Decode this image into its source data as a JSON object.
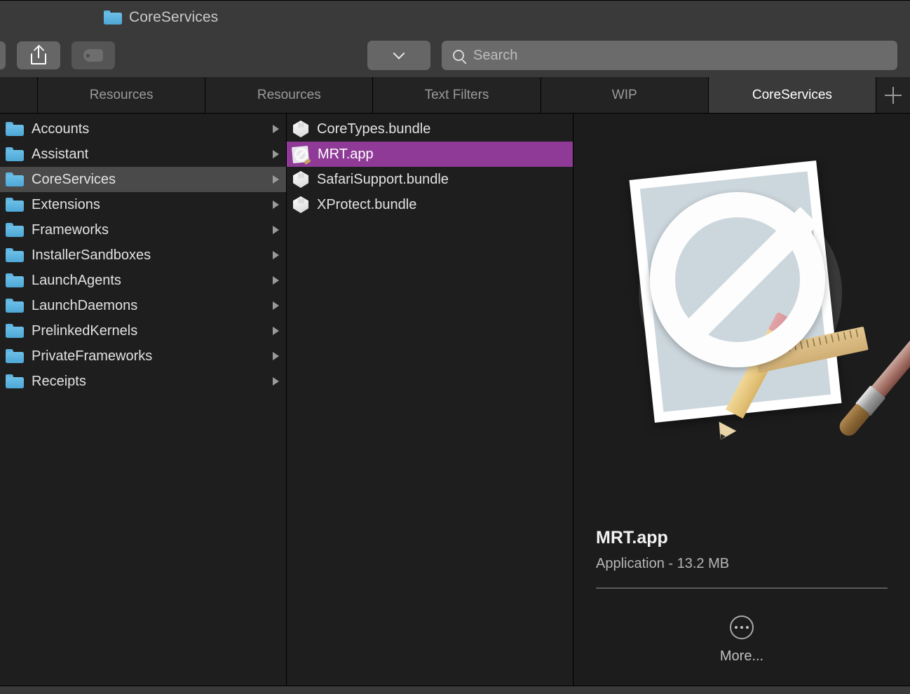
{
  "window": {
    "title": "CoreServices",
    "title_folder_icon": "folder-icon"
  },
  "toolbar": {
    "share_button_label": "Share",
    "tag_button_label": "Tags",
    "group_dropdown_label": "Group",
    "search": {
      "placeholder": "Search",
      "value": "",
      "icon": "search-icon"
    }
  },
  "tabbar": {
    "tabs": [
      {
        "label": "",
        "active": false
      },
      {
        "label": "Resources",
        "active": false
      },
      {
        "label": "Resources",
        "active": false
      },
      {
        "label": "Text Filters",
        "active": false
      },
      {
        "label": "WIP",
        "active": false
      },
      {
        "label": "CoreServices",
        "active": true
      }
    ],
    "add_tab_label": "+"
  },
  "sidebar": {
    "items": [
      {
        "label": "Accounts",
        "selected": false
      },
      {
        "label": "Assistant",
        "selected": false
      },
      {
        "label": "CoreServices",
        "selected": true
      },
      {
        "label": "Extensions",
        "selected": false
      },
      {
        "label": "Frameworks",
        "selected": false
      },
      {
        "label": "InstallerSandboxes",
        "selected": false
      },
      {
        "label": "LaunchAgents",
        "selected": false
      },
      {
        "label": "LaunchDaemons",
        "selected": false
      },
      {
        "label": "PrelinkedKernels",
        "selected": false
      },
      {
        "label": "PrivateFrameworks",
        "selected": false
      },
      {
        "label": "Receipts",
        "selected": false
      }
    ]
  },
  "files": {
    "items": [
      {
        "label": "CoreTypes.bundle",
        "icon": "bundle-icon",
        "selected": false
      },
      {
        "label": "MRT.app",
        "icon": "app-prohibited-icon",
        "selected": true
      },
      {
        "label": "SafariSupport.bundle",
        "icon": "bundle-icon",
        "selected": false
      },
      {
        "label": "XProtect.bundle",
        "icon": "bundle-icon",
        "selected": false
      }
    ]
  },
  "preview": {
    "icon": "app-prohibited-icon",
    "name": "MRT.app",
    "kind_and_size": "Application - 13.2 MB",
    "more_label": "More..."
  },
  "colors": {
    "selection_purple": "#8e3a96",
    "sidebar_selection_gray": "#4a4a4a",
    "folder_blue": "#5fb5e0",
    "window_background": "#1e1e1e",
    "chrome_gray": "#3a3a3a"
  }
}
